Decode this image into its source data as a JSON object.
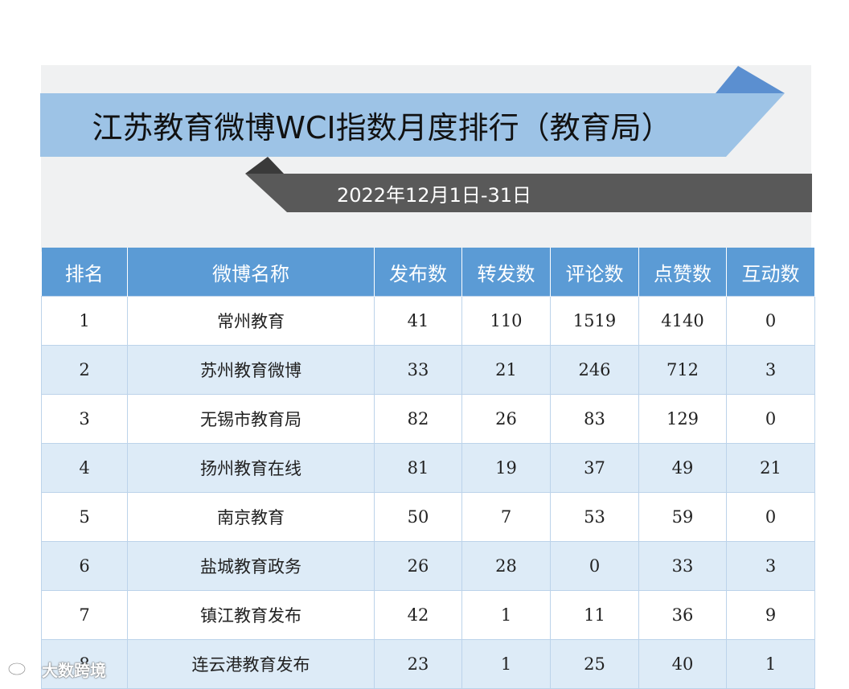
{
  "title": "江苏教育微博WCI指数月度排行（教育局）",
  "date_range": "2022年12月1日-31日",
  "colors": {
    "header_bg": "#5b9bd5",
    "title_band": "#9dc3e6",
    "date_band": "#595959",
    "row_alt": "#ddebf7"
  },
  "table": {
    "headers": [
      "排名",
      "微博名称",
      "发布数",
      "转发数",
      "评论数",
      "点赞数",
      "互动数"
    ],
    "rows": [
      [
        "1",
        "常州教育",
        "41",
        "110",
        "1519",
        "4140",
        "0"
      ],
      [
        "2",
        "苏州教育微博",
        "33",
        "21",
        "246",
        "712",
        "3"
      ],
      [
        "3",
        "无锡市教育局",
        "82",
        "26",
        "83",
        "129",
        "0"
      ],
      [
        "4",
        "扬州教育在线",
        "81",
        "19",
        "37",
        "49",
        "21"
      ],
      [
        "5",
        "南京教育",
        "50",
        "7",
        "53",
        "59",
        "0"
      ],
      [
        "6",
        "盐城教育政务",
        "26",
        "28",
        "0",
        "33",
        "3"
      ],
      [
        "7",
        "镇江教育发布",
        "42",
        "1",
        "11",
        "36",
        "9"
      ],
      [
        "8",
        "连云港教育发布",
        "23",
        "1",
        "25",
        "40",
        "1"
      ]
    ]
  },
  "watermark": {
    "icon": "weibo-logo-icon",
    "text": "大数跨境"
  }
}
